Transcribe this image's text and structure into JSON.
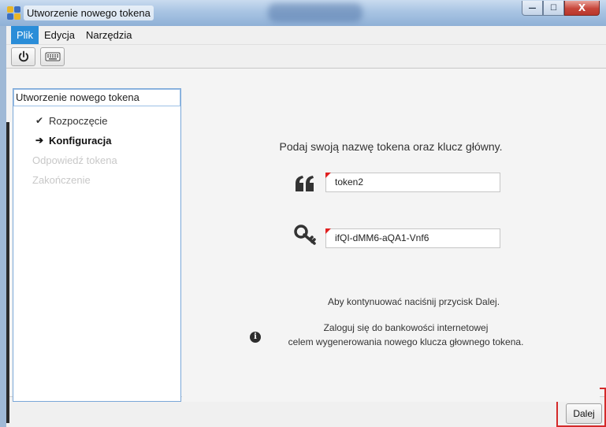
{
  "window": {
    "title": "Utworzenie nowego tokena",
    "minimize_label": "—",
    "maximize_label": "☐",
    "close_label": "X"
  },
  "menu": {
    "items": [
      "Plik",
      "Edycja",
      "Narzędzia"
    ]
  },
  "toolbar": {
    "buttons": [
      "power-icon",
      "keyboard-icon"
    ]
  },
  "steps": {
    "header": "Utworzenie nowego tokena",
    "items": [
      {
        "label": "Rozpoczęcie",
        "state": "done",
        "icon": "checkmark-icon"
      },
      {
        "label": "Konfiguracja",
        "state": "current",
        "icon": "arrow-right-icon"
      },
      {
        "label": "Odpowiedź tokena",
        "state": "disabled"
      },
      {
        "label": "Zakończenie",
        "state": "disabled"
      }
    ]
  },
  "form": {
    "prompt": "Podaj swoją nazwę tokena oraz klucz główny.",
    "token_name_value": "token2",
    "master_key_value": "ifQI-dMM6-aQA1-Vnf6",
    "continue_note": "Aby kontynuować naciśnij przycisk Dalej.",
    "info_line1": "Zaloguj się do bankowości internetowej",
    "info_line2": "celem wygenerowania nowego klucza głownego tokena."
  },
  "footer": {
    "next_label": "Dalej"
  },
  "colors": {
    "menu_active": "#2a8dd8",
    "highlight_border": "#d42a2a",
    "field_marker": "#e02020",
    "panel_border": "#7aa7d8"
  }
}
